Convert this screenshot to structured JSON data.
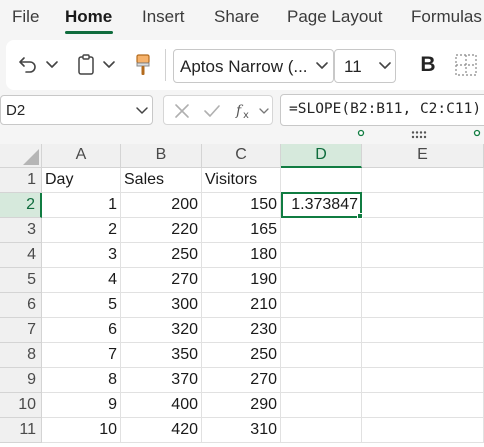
{
  "menu": {
    "tabs": [
      "File",
      "Home",
      "Insert",
      "Share",
      "Page Layout",
      "Formulas"
    ],
    "active_index": 1
  },
  "ribbon": {
    "undo_icon": "undo-icon",
    "paste_icon": "clipboard-icon",
    "format_painter_icon": "paintbrush-icon",
    "font_name": "Aptos Narrow (...",
    "font_size": "11",
    "bold_label": "B",
    "borders_icon": "borders-icon"
  },
  "formula_bar": {
    "name_box": "D2",
    "formula": "=SLOPE(B2:B11, C2:C11)"
  },
  "grid": {
    "columns": [
      "A",
      "B",
      "C",
      "D",
      "E"
    ],
    "selected_column": "D",
    "selected_row": "2",
    "rows": [
      {
        "row": "1",
        "cells": [
          "Day",
          "Sales",
          "Visitors",
          "",
          ""
        ]
      },
      {
        "row": "2",
        "cells": [
          "1",
          "200",
          "150",
          "1.373847",
          ""
        ]
      },
      {
        "row": "3",
        "cells": [
          "2",
          "220",
          "165",
          "",
          ""
        ]
      },
      {
        "row": "4",
        "cells": [
          "3",
          "250",
          "180",
          "",
          ""
        ]
      },
      {
        "row": "5",
        "cells": [
          "4",
          "270",
          "190",
          "",
          ""
        ]
      },
      {
        "row": "6",
        "cells": [
          "5",
          "300",
          "210",
          "",
          ""
        ]
      },
      {
        "row": "7",
        "cells": [
          "6",
          "320",
          "230",
          "",
          ""
        ]
      },
      {
        "row": "8",
        "cells": [
          "7",
          "350",
          "250",
          "",
          ""
        ]
      },
      {
        "row": "9",
        "cells": [
          "8",
          "370",
          "270",
          "",
          ""
        ]
      },
      {
        "row": "10",
        "cells": [
          "9",
          "400",
          "290",
          "",
          ""
        ]
      },
      {
        "row": "11",
        "cells": [
          "10",
          "420",
          "310",
          "",
          ""
        ]
      }
    ]
  },
  "colors": {
    "accent": "#107c41",
    "selected_header_bg": "#d6e9dc",
    "chrome_bg": "#f5f5f5"
  }
}
